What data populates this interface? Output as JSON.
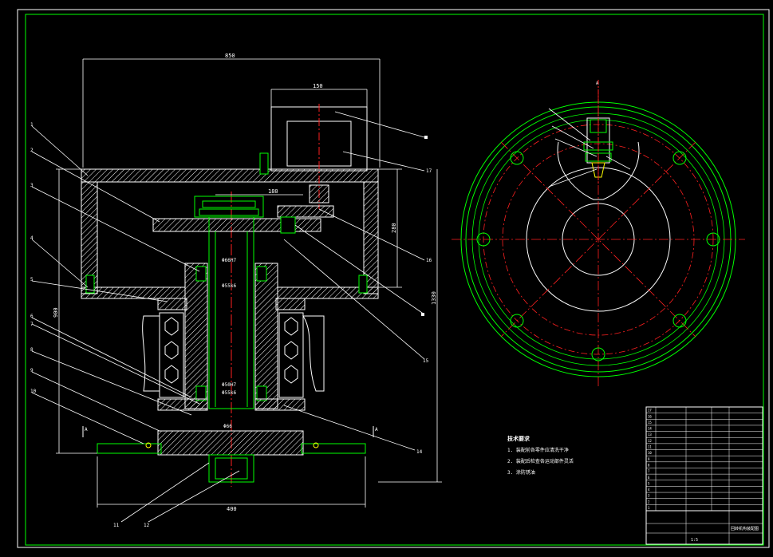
{
  "colors": {
    "background": "#000000",
    "outline": "#ffffff",
    "section": "#00ff00",
    "center": "#ff2020",
    "dimension": "#ffffff",
    "note": "#ffffff"
  },
  "dimensions": {
    "width_total": "850",
    "width_top": "150",
    "width_mid": "180",
    "height_right_small": "280",
    "height_right_total": "1330",
    "height_left": "900",
    "width_base": "400",
    "fit_upper_1": "Φ66H7",
    "fit_upper_2": "Φ55k6",
    "fit_lower_1": "Φ50H7",
    "fit_lower_2": "Φ55k6",
    "fit_base": "Φ66"
  },
  "leaders": {
    "left": [
      "1",
      "2",
      "3",
      "4",
      "5",
      "6",
      "7",
      "8",
      "9",
      "10"
    ],
    "right": [
      "17",
      "16",
      "15",
      "14",
      "13"
    ],
    "bottom": [
      "11",
      "12"
    ]
  },
  "section_marks": {
    "a": "A",
    "b": "A",
    "top": "A"
  },
  "notes": {
    "heading": "技术要求",
    "lines": [
      "1. 装配前各零件应清洗干净",
      "2. 装配后检查各运动部件灵活",
      "3. 涂防锈油"
    ]
  },
  "title_block": {
    "rows": [
      "1",
      "2",
      "3",
      "4",
      "5",
      "6",
      "7",
      "8",
      "9",
      "10",
      "11",
      "12",
      "13",
      "14",
      "15",
      "16",
      "17"
    ],
    "drawing_name": "回转机构装配图",
    "scale": "1:5"
  }
}
